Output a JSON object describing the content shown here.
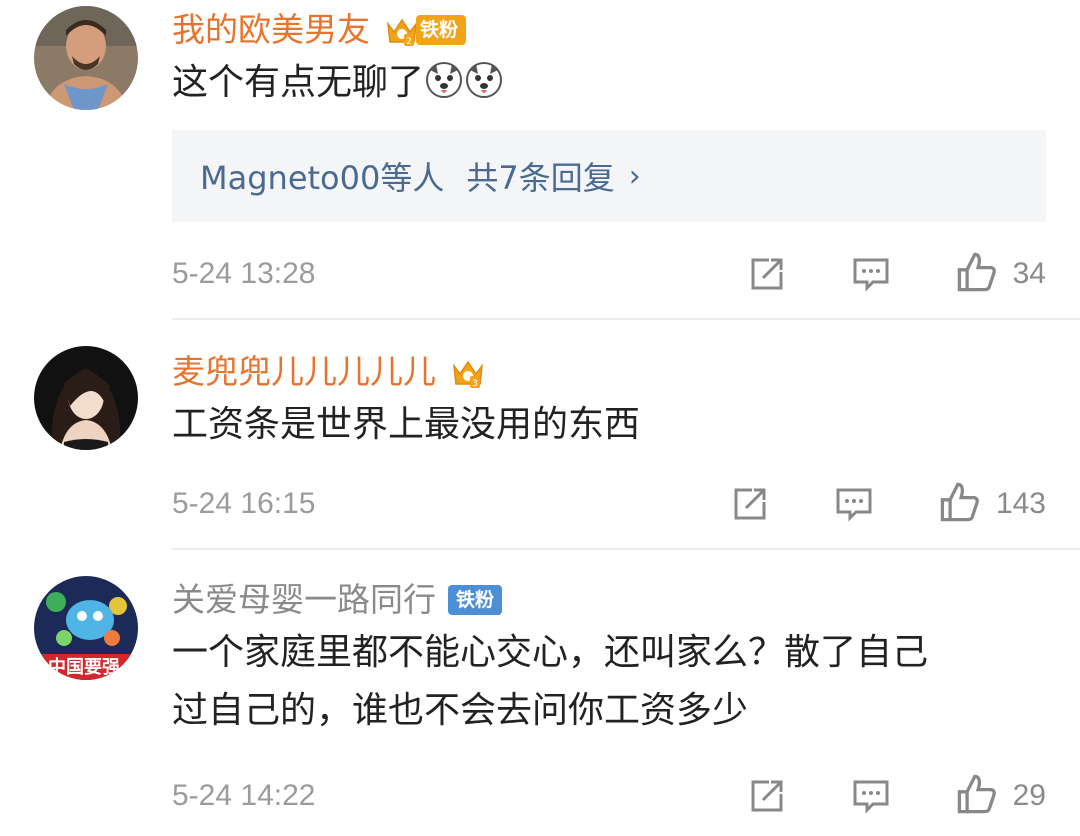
{
  "comments": [
    {
      "username": "我的欧美男友",
      "fan_label": "铁粉",
      "text": "这个有点无聊了",
      "emoji": [
        "dog-emoji",
        "dog-emoji"
      ],
      "reply_summary": {
        "users": "Magneto00等人",
        "count_text": "共7条回复",
        "chevron": "›"
      },
      "timestamp": "5-24 13:28",
      "likes": "34"
    },
    {
      "username": "麦兜兜儿儿儿儿儿",
      "text": "工资条是世界上最没用的东西",
      "timestamp": "5-24 16:15",
      "likes": "143"
    },
    {
      "username": "关爱母婴一路同行",
      "fan_label": "铁粉",
      "avatar_text": "中国要强",
      "text": "一个家庭里都不能心交心，还叫家么？散了自己过自己的，谁也不会去问你工资多少",
      "text_line1": "一个家庭里都不能心交心，还叫家么？散了自己",
      "text_line2": "过自己的，谁也不会去问你工资多少",
      "timestamp": "5-24 14:22",
      "likes": "29"
    }
  ],
  "icons": {
    "share": "share-icon",
    "comment": "comment-icon",
    "like": "thumbs-up-icon",
    "crown": "crown-icon"
  },
  "colors": {
    "username_orange": "#e8732c",
    "username_gray": "#8a8a8a",
    "reply_blue": "#4a6a90",
    "fan_gold": "#f2a419",
    "fan_blue": "#4d8fd6",
    "meta_gray": "#9b9b9b"
  }
}
